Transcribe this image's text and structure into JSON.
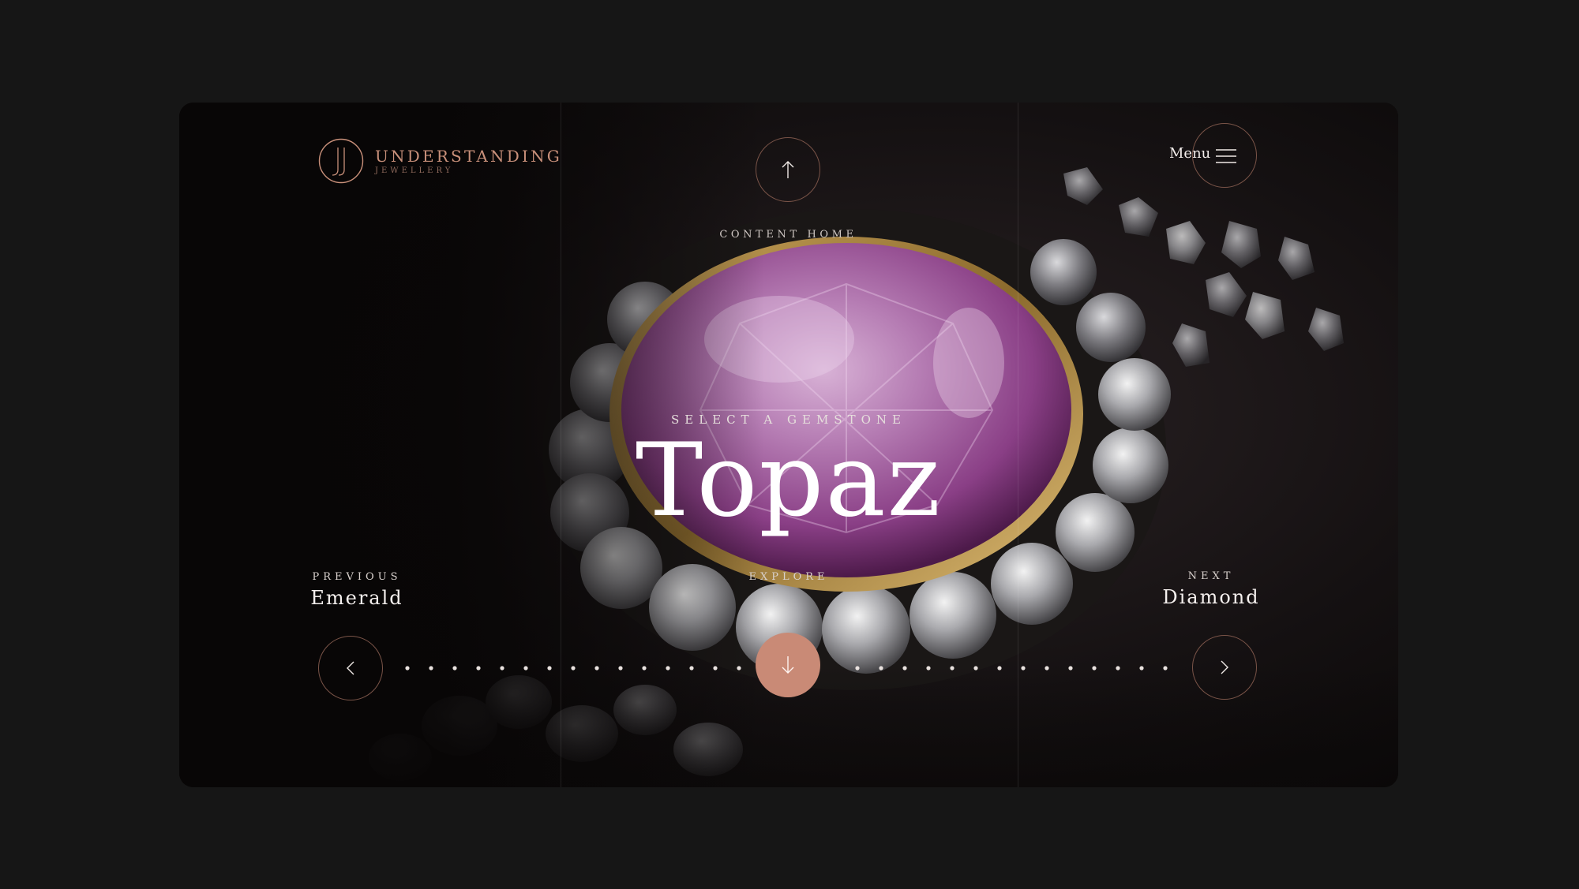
{
  "brand": {
    "title": "UNDERSTANDING",
    "subtitle": "JEWELLERY"
  },
  "header": {
    "content_home_label": "CONTENT HOME",
    "menu_label": "Menu"
  },
  "hero": {
    "eyebrow": "SELECT A GEMSTONE",
    "gemstone": "Topaz"
  },
  "navigation": {
    "previous_label": "PREVIOUS",
    "previous_name": "Emerald",
    "explore_label": "EXPLORE",
    "next_label": "NEXT",
    "next_name": "Diamond"
  },
  "colors": {
    "accent": "#c98a76",
    "page_background": "#161616",
    "card_background": "#0a0808",
    "ring_border": "#7a5448"
  },
  "icons": {
    "up": "arrow-up-icon",
    "menu": "hamburger-icon",
    "down": "arrow-down-icon",
    "prev": "chevron-left-icon",
    "next": "chevron-right-icon"
  }
}
